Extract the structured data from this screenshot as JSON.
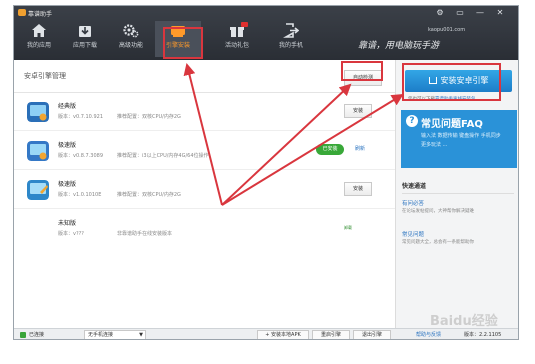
{
  "app": {
    "title": "靠谱助手",
    "site": "kaopu001.com",
    "slogan": "靠谱，用电脑玩手游"
  },
  "window": {
    "controls": [
      "⚙",
      "▭",
      "—",
      "✕"
    ]
  },
  "nav": [
    {
      "label": "我的应用",
      "icon": "home-icon"
    },
    {
      "label": "应用下载",
      "icon": "download-icon"
    },
    {
      "label": "高级功能",
      "icon": "gears-icon"
    },
    {
      "label": "引擎安装",
      "icon": "engine-icon",
      "active": true
    },
    {
      "label": "活动礼包",
      "icon": "gift-icon",
      "badge": true
    },
    {
      "label": "我的手机",
      "icon": "phone-export-icon"
    }
  ],
  "left": {
    "section_title": "安卓引擎管理",
    "auto_detect": "自动检测",
    "engines": [
      {
        "name": "经典版",
        "version": "版本：v0.7.10.921",
        "recommend": "推荐配置：双核CPU/内存2G",
        "action": "安装",
        "icon_color": "#2a6fb8"
      },
      {
        "name": "极速版",
        "version": "版本：v0.8.7.3089",
        "recommend": "推荐配置：i3以上CPU/内存4G/64位操作",
        "installed_label": "已安装",
        "refresh_label": "刷新",
        "icon_color": "#3478c6"
      },
      {
        "name": "极速版",
        "version": "版本：v1.0.1010E",
        "recommend": "推荐配置：双核CPU/内存2G",
        "action": "安装",
        "icon_color": "#2d87c9"
      },
      {
        "name": "未知版",
        "version": "版本：v???",
        "recommend": "非靠谱助手在线安装版本",
        "status": "卸载",
        "icon_color": "#ffffff"
      }
    ]
  },
  "right": {
    "install_button": "安装安卓引擎",
    "download_note_prefix": "您也可以下载",
    "download_note_link": "靠谱助手离线安装包",
    "faq_title": "常见问题FAQ",
    "faq_sub": "输入法  数据传输  键盘操作  手机同步  更多玩法  ...",
    "quick_title": "快速通道",
    "quick_items": [
      {
        "title": "有问必答",
        "desc": "在论坛发帖提问，大神帮你解决疑难"
      },
      {
        "title": "常见问题",
        "desc": "常见问题大全，总会有一条能帮助你"
      }
    ]
  },
  "footer": {
    "connected": "已连接",
    "device_select": "无手机连接",
    "install_local_apk": "+ 安装本地APK",
    "restart_engine": "重启引擎",
    "exit_engine": "退出引擎",
    "help_feedback": "帮助与反馈",
    "version": "版本：2.2.1105"
  },
  "watermark": "Baidu经验",
  "colors": {
    "header": "#2f343b",
    "accent": "#1d8fd8",
    "highlight": "#d9363e",
    "installed": "#38a838"
  }
}
